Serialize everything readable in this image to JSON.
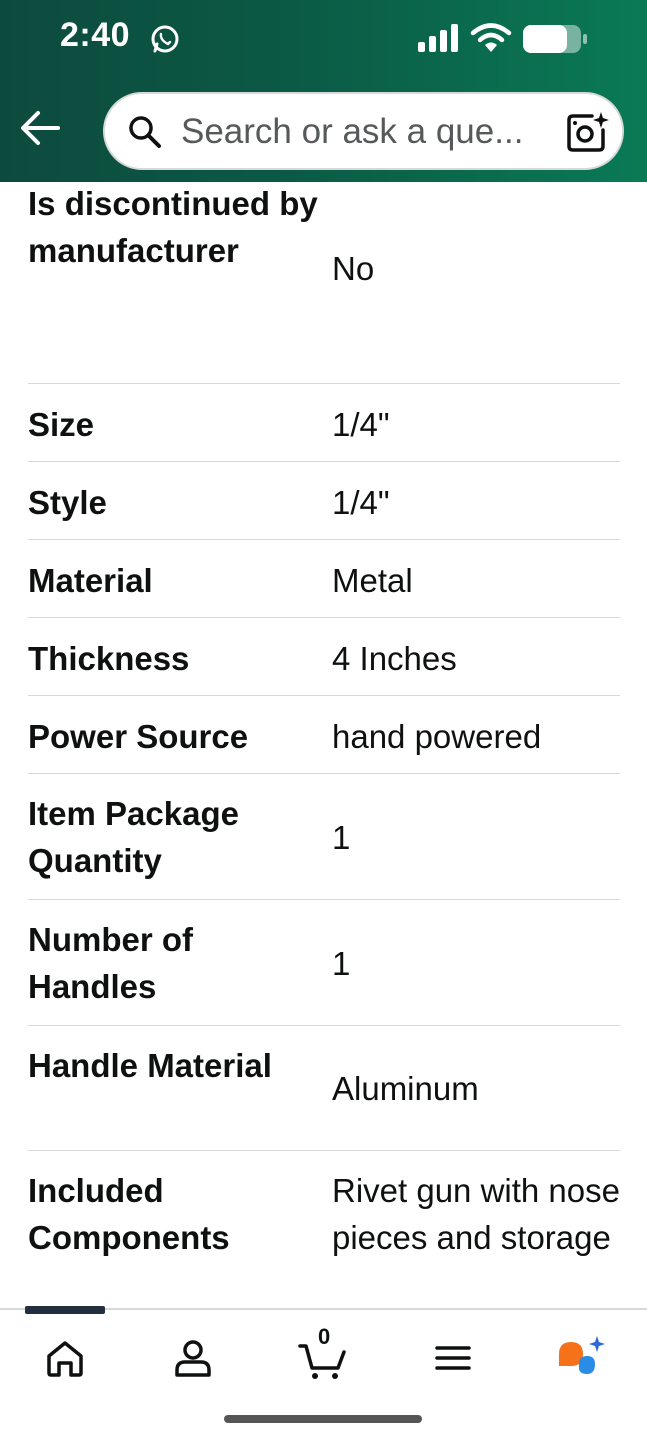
{
  "status_bar": {
    "time": "2:40"
  },
  "header": {
    "search_placeholder": "Search or ask a que..."
  },
  "details": [
    {
      "label": "Is discontinued by manufacturer",
      "value": "No"
    },
    {
      "label": "Size",
      "value": "1/4\""
    },
    {
      "label": "Style",
      "value": "1/4\""
    },
    {
      "label": "Material",
      "value": "Metal"
    },
    {
      "label": "Thickness",
      "value": "4 Inches"
    },
    {
      "label": "Power Source",
      "value": "hand powered"
    },
    {
      "label": "Item Package Quantity",
      "value": "1"
    },
    {
      "label": "Number of Handles",
      "value": "1"
    },
    {
      "label": "Handle Material",
      "value": "Aluminum"
    },
    {
      "label": "Included Components",
      "value": "Rivet gun with nose pieces and storage"
    }
  ],
  "bottom_nav": {
    "items": [
      "home-icon",
      "account-icon",
      "cart-icon",
      "menu-icon",
      "rufus-icon"
    ],
    "cart_count": "0"
  },
  "colors": {
    "header_start": "#0d4a3e",
    "header_end": "#0a7a55",
    "rufus_orange": "#f5721b",
    "rufus_blue": "#2b8ce6"
  }
}
